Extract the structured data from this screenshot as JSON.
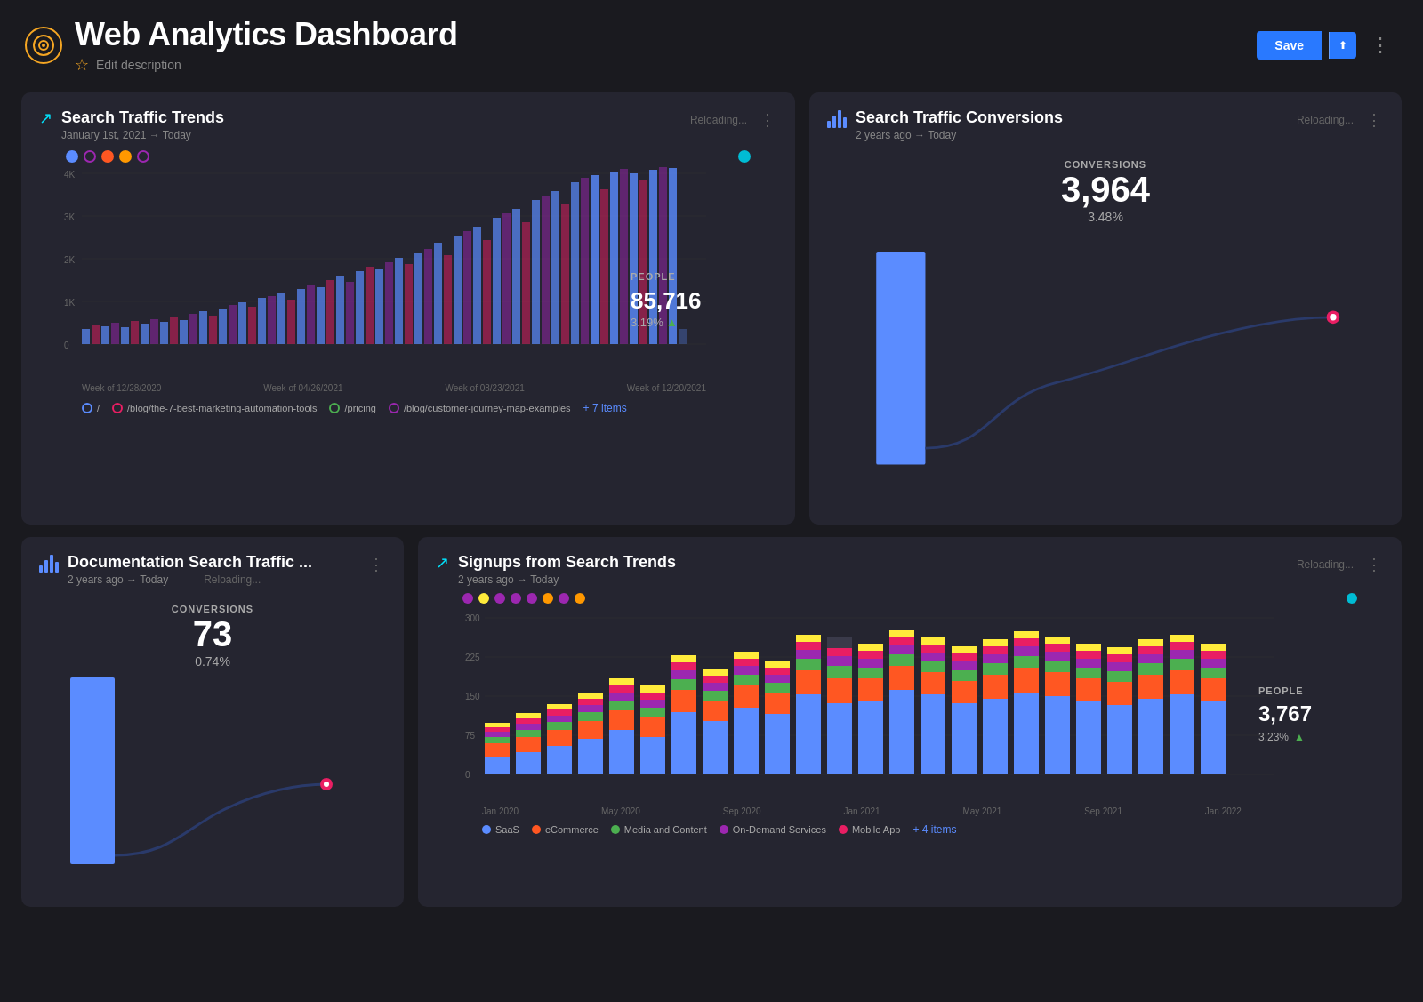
{
  "header": {
    "title": "Web Analytics Dashboard",
    "subtitle": "Edit description",
    "save_label": "Save",
    "more_icon": "⋮"
  },
  "cards": {
    "trends": {
      "title": "Search Traffic Trends",
      "subtitle": "January 1st, 2021 → Today",
      "reloading": "Reloading...",
      "people_label": "PEOPLE",
      "people_value": "85,716",
      "people_change": "3.19%",
      "x_labels": [
        "Week of 12/28/2020",
        "Week of 04/26/2021",
        "Week of 08/23/2021",
        "Week of 12/20/2021"
      ],
      "y_labels": [
        "4K",
        "3K",
        "2K",
        "1K",
        "0"
      ],
      "legend": [
        {
          "label": "/",
          "color": "#5b8cff",
          "border": "#5b8cff"
        },
        {
          "label": "/blog/the-7-best-marketing-automation-tools",
          "color": "transparent",
          "border": "#e91e63"
        },
        {
          "label": "/pricing",
          "color": "transparent",
          "border": "#4caf50"
        },
        {
          "label": "/blog/customer-journey-map-examples",
          "color": "transparent",
          "border": "#9c27b0"
        },
        {
          "label": "+ 7 items",
          "color": null,
          "border": null
        }
      ]
    },
    "conversions": {
      "title": "Search Traffic Conversions",
      "subtitle": "2 years ago → Today",
      "reloading": "Reloading...",
      "conv_label": "CONVERSIONS",
      "conv_value": "3,964",
      "conv_pct": "3.48%"
    },
    "doc_search": {
      "title": "Documentation Search Traffic ...",
      "subtitle": "2 years ago → Today",
      "reloading": "Reloading...",
      "conv_label": "CONVERSIONS",
      "conv_value": "73",
      "conv_pct": "0.74%"
    },
    "signups": {
      "title": "Signups from Search Trends",
      "subtitle": "2 years ago → Today",
      "reloading": "Reloading...",
      "people_label": "PEOPLE",
      "people_value": "3,767",
      "people_change": "3.23%",
      "x_labels": [
        "Jan 2020",
        "May 2020",
        "Sep 2020",
        "Jan 2021",
        "May 2021",
        "Sep 2021",
        "Jan 2022"
      ],
      "y_labels": [
        "300",
        "225",
        "150",
        "75",
        "0"
      ],
      "legend": [
        {
          "label": "SaaS",
          "color": "#5b8cff"
        },
        {
          "label": "eCommerce",
          "color": "#ff5722"
        },
        {
          "label": "Media and Content",
          "color": "#4caf50"
        },
        {
          "label": "On-Demand Services",
          "color": "#9c27b0"
        },
        {
          "label": "Mobile App",
          "color": "#e91e63"
        }
      ],
      "plus_items": "+ 4 items"
    }
  }
}
